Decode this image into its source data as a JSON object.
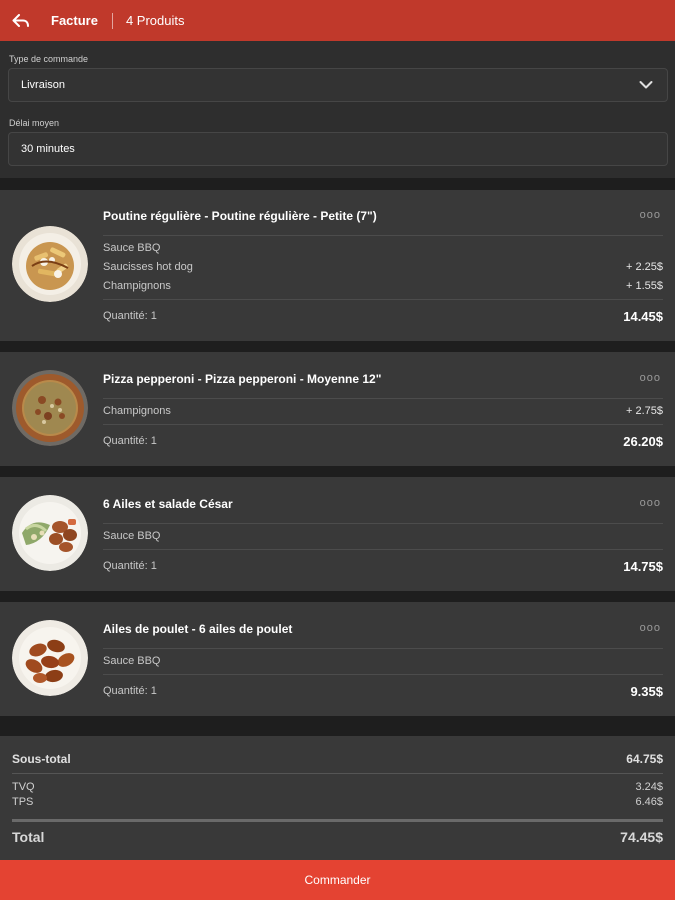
{
  "header": {
    "title": "Facture",
    "count": "4 Produits"
  },
  "order_type": {
    "label": "Type de commande",
    "value": "Livraison"
  },
  "delay": {
    "label": "Délai moyen",
    "value": "30 minutes"
  },
  "items": [
    {
      "title": "Poutine régulière - Poutine régulière - Petite (7\")",
      "more": "ooo",
      "options": [
        {
          "name": "Sauce BBQ",
          "price": ""
        },
        {
          "name": "Saucisses hot dog",
          "price": "+ 2.25$"
        },
        {
          "name": "Champignons",
          "price": "+ 1.55$"
        }
      ],
      "quantity": "Quantité: 1",
      "total": "14.45$"
    },
    {
      "title": "Pizza pepperoni - Pizza pepperoni - Moyenne 12\"",
      "more": "ooo",
      "options": [
        {
          "name": "Champignons",
          "price": "+ 2.75$"
        }
      ],
      "quantity": "Quantité: 1",
      "total": "26.20$"
    },
    {
      "title": "6 Ailes et salade César",
      "more": "ooo",
      "options": [
        {
          "name": "Sauce BBQ",
          "price": ""
        }
      ],
      "quantity": "Quantité: 1",
      "total": "14.75$"
    },
    {
      "title": "Ailes de poulet - 6 ailes de poulet",
      "more": "ooo",
      "options": [
        {
          "name": "Sauce BBQ",
          "price": ""
        }
      ],
      "quantity": "Quantité: 1",
      "total": "9.35$"
    }
  ],
  "summary": {
    "subtotal_label": "Sous-total",
    "subtotal": "64.75$",
    "tvq_label": "TVQ",
    "tvq": "3.24$",
    "tps_label": "TPS",
    "tps": "6.46$",
    "total_label": "Total",
    "total": "74.45$"
  },
  "order_button": "Commander",
  "colors": {
    "header": "#c0392b",
    "button": "#e44332",
    "card": "#393939",
    "background": "#1e1e1e"
  },
  "icons": {
    "back": "reply-arrow-icon",
    "dropdown": "chevron-down-icon",
    "more": "more-options-icon"
  }
}
